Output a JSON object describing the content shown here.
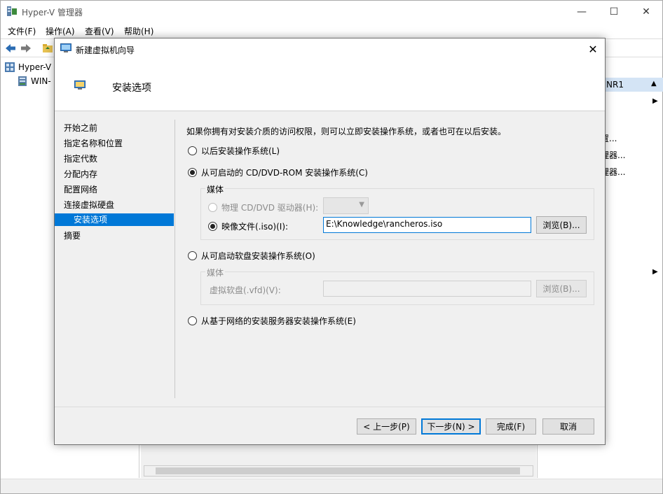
{
  "app": {
    "title": "Hyper-V 管理器",
    "window_controls": {
      "minimize": "—",
      "maximize": "☐",
      "close": "✕"
    }
  },
  "menu": {
    "file": "文件(F)",
    "action": "操作(A)",
    "view": "查看(V)",
    "help": "帮助(H)"
  },
  "tree": {
    "root": "Hyper-V",
    "host": "WIN-"
  },
  "actions": {
    "header": "NR1",
    "items": [
      "",
      "置...",
      "理器...",
      "理器..."
    ]
  },
  "dialog": {
    "title": "新建虚拟机向导",
    "close_glyph": "✕",
    "header_title": "安装选项",
    "steps": [
      {
        "label": "开始之前"
      },
      {
        "label": "指定名称和位置"
      },
      {
        "label": "指定代数"
      },
      {
        "label": "分配内存"
      },
      {
        "label": "配置网络"
      },
      {
        "label": "连接虚拟硬盘"
      },
      {
        "label": "安装选项"
      },
      {
        "label": "摘要"
      }
    ],
    "intro": "如果你拥有对安装介质的访问权限，则可以立即安装操作系统，或者也可在以后安装。",
    "option_later": "以后安装操作系统(L)",
    "option_cd": "从可启动的 CD/DVD-ROM 安装操作系统(C)",
    "cd_group_title": "媒体",
    "physical_drive_label": "物理 CD/DVD 驱动器(H):",
    "image_file_label": "映像文件(.iso)(I):",
    "image_file_value": "E:\\Knowledge\\rancheros.iso",
    "browse_label": "浏览(B)...",
    "option_floppy": "从可启动软盘安装操作系统(O)",
    "floppy_group_title": "媒体",
    "floppy_label": "虚拟软盘(.vfd)(V):",
    "floppy_browse_label": "浏览(B)...",
    "option_network": "从基于网络的安装服务器安装操作系统(E)",
    "buttons": {
      "prev": "< 上一步(P)",
      "next": "下一步(N) >",
      "finish": "完成(F)",
      "cancel": "取消"
    }
  },
  "colors": {
    "accent": "#0078d7",
    "actions_header": "#d4e4f5"
  }
}
